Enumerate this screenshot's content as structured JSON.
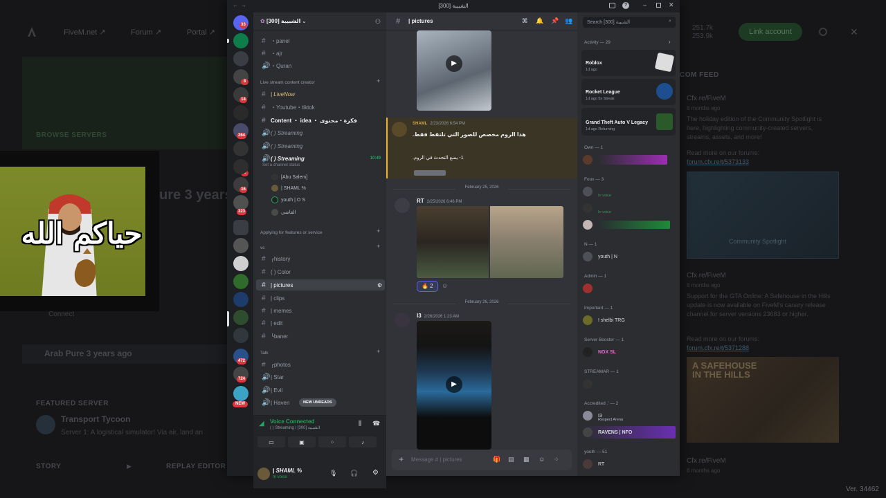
{
  "launcher": {
    "nav": [
      "FiveM.net ↗",
      "Forum ↗",
      "Portal ↗"
    ],
    "stats": [
      "251.7k",
      "253.9k"
    ],
    "link_account": "Link account",
    "browse_servers": "BROWSE SERVERS",
    "server_title": "ure 3 years",
    "connect": "Connect",
    "history_item": "Arab Pure 3 years ago",
    "featured_label": "FEATURED SERVER",
    "featured_name": "Transport Tycoon",
    "featured_desc": "Server 1: A logistical simulator! Via air, land an",
    "story": "STORY",
    "replay_editor": "REPLAY EDITOR",
    "feed_title": "COM FEED",
    "feed": [
      {
        "source": "Cfx.re/FiveM",
        "age": "8 months ago",
        "text": "The holiday edition of the Community Spotlight is here, highlighting community-created servers, streams, assets, and more!",
        "read_more": "Read more on our forums:",
        "link": "forum.cfx.re/t/5373133",
        "image_title": "Community Spotlight"
      },
      {
        "source": "Cfx.re/FiveM",
        "age": "8 months ago",
        "text": "Support for the GTA Online: A Safehouse in the Hills update is now available on FiveM's canary release channel for server versions 23683 or higher.",
        "read_more": "Read more on our forums:",
        "link": "forum.cfx.re/t/5371288",
        "image_title": "A SAFEHOUSE IN THE HILLS"
      },
      {
        "source": "Cfx.re/FiveM",
        "age": "8 months ago"
      }
    ],
    "version": "Ver. 34462"
  },
  "webcam": {
    "caption": "حياكم الله"
  },
  "discord": {
    "window_title": "الشبيبة [300]",
    "server_badges": [
      "33",
      "8",
      "14",
      "264",
      "3",
      "16",
      "323",
      "472",
      "724"
    ],
    "new_badge": "NEW",
    "guild_name": "الشبيبة [300]",
    "channels_top": [
      {
        "icon": "#",
        "name": "・panel"
      },
      {
        "icon": "#",
        "name": "・ajr"
      },
      {
        "icon": "🔊",
        "name": "・Quran"
      }
    ],
    "cat_live": "Live stream content creator",
    "channels_live": [
      {
        "icon": "#",
        "name": "| LiveNow"
      },
      {
        "icon": "#",
        "name": "・Youtube・tiktok"
      },
      {
        "icon": "#",
        "name": "Content ・ idea ・ فكرة・محتوى"
      },
      {
        "icon": "🔊",
        "name": "( ) Streaming"
      },
      {
        "icon": "🔊",
        "name": "( ) Streaming"
      },
      {
        "icon": "🔊",
        "name": "( ) Streaming",
        "extra": "10:49",
        "status": "Set a channel status"
      }
    ],
    "voice_users": [
      "[Abu Salem]",
      "| SHAML %",
      "youth | O S",
      "القاضي"
    ],
    "cat_apply": "Applying for features or service",
    "cat_vc": "vc",
    "channels_vc": [
      {
        "icon": "#",
        "name": "╭history"
      },
      {
        "icon": "#",
        "name": "( ) Color"
      },
      {
        "icon": "#",
        "name": "| pictures"
      },
      {
        "icon": "#",
        "name": "| clips"
      },
      {
        "icon": "#",
        "name": "| memes"
      },
      {
        "icon": "#",
        "name": "| edit"
      },
      {
        "icon": "#",
        "name": "╰baner"
      }
    ],
    "cat_talk": "Talk",
    "channels_talk": [
      {
        "icon": "#",
        "name": "╭photos"
      },
      {
        "icon": "🔊",
        "name": "| Star"
      },
      {
        "icon": "🔊",
        "name": "| Evil"
      },
      {
        "icon": "🔊",
        "name": "| Haven"
      }
    ],
    "new_unreads": "NEW UNREADS",
    "voice_connected": "Voice Connected",
    "voice_channel": "( ) Streaming / الشبيبة [300]",
    "user_name": "| SHAML %",
    "user_status": "In voice",
    "chat_channel": "| pictures",
    "messages": [
      {
        "author": "SHAML",
        "time": "2/23/2026 6:54 PM",
        "text1": "هذا الروم مخصص للصور التي تلتقط فقط.",
        "text2": "1- يمنع التحدث في الروم."
      },
      {
        "date": "February 25, 2026"
      },
      {
        "author": "RT",
        "time": "2/25/2026 6:46 PM",
        "reaction": "🔥 2"
      },
      {
        "date": "February 26, 2026"
      },
      {
        "author": "I3",
        "time": "2/26/2026 1:23 AM"
      }
    ],
    "composer_placeholder": "Message # | pictures",
    "search_placeholder": "Search الشبيبة [300]",
    "activity_header": "Activity — 29",
    "activities": [
      {
        "game": "Roblox",
        "sub": "1d ago"
      },
      {
        "game": "Rocket League",
        "sub": "1d ago  5x Streak"
      },
      {
        "game": "Grand Theft Auto V Legacy",
        "sub": "1d ago  Returning"
      }
    ],
    "member_groups": [
      {
        "title": "Own — 1"
      },
      {
        "title": "Foux — 3",
        "members": [
          "In voice",
          "In voice"
        ]
      },
      {
        "title": "N — 1",
        "members": [
          "youth | N"
        ]
      },
      {
        "title": "Admin — 1"
      },
      {
        "title": "Important — 1",
        "members": [
          "! shelbi TRG"
        ]
      },
      {
        "title": "Server Booster — 1",
        "members": [
          "NOX SL"
        ]
      },
      {
        "title": "STREAMAR — 1"
      },
      {
        "title": "Accredited .' — 2",
        "members": [
          "I3",
          "RAVENS | NFO"
        ]
      },
      {
        "title": "youth — 51",
        "members": [
          "RT"
        ]
      }
    ],
    "member_sub": [
      "Respect Arena"
    ]
  }
}
